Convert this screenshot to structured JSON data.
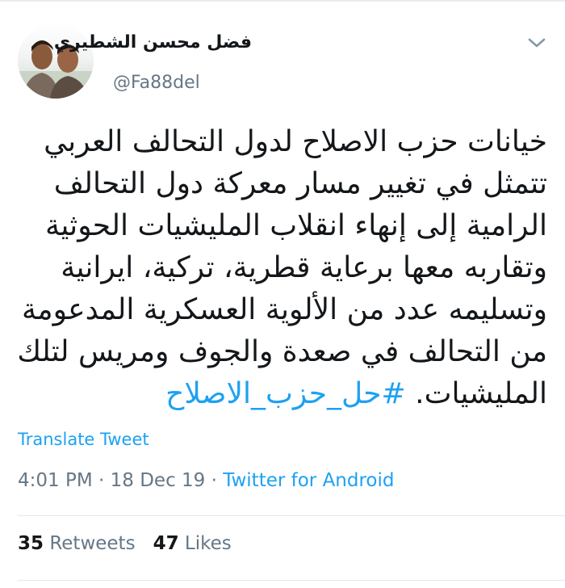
{
  "author": {
    "display_name": "فضل محسن الشطيري",
    "handle": "@Fa88del"
  },
  "tweet": {
    "lines": [
      "خيانات حزب الاصلاح لدول التحالف العربي",
      "تتمثل في تغيير مسار معركة دول التحالف",
      "الرامية إلى إنهاء انقلاب المليشيات الحوثية",
      "وتقاربه معها برعاية قطرية، تركية، ايرانية",
      "وتسليمه عدد من الألوية العسكرية المدعومة",
      "من التحالف في صعدة والجوف ومريس لتلك",
      "المليشيات."
    ],
    "hashtag": "#حل_حزب_الاصلاح"
  },
  "translate_label": "Translate Tweet",
  "meta": {
    "time": "4:01 PM",
    "separator": " · ",
    "date": "18 Dec 19",
    "source": "Twitter for Android"
  },
  "stats": {
    "retweets_count": "35",
    "retweets_label": "Retweets",
    "likes_count": "47",
    "likes_label": "Likes"
  },
  "icons": {
    "caret": "chevron-down-icon",
    "avatar": "profile-photo"
  },
  "colors": {
    "link": "#1da1f2",
    "secondary_text": "#657786",
    "primary_text": "#14171a"
  }
}
